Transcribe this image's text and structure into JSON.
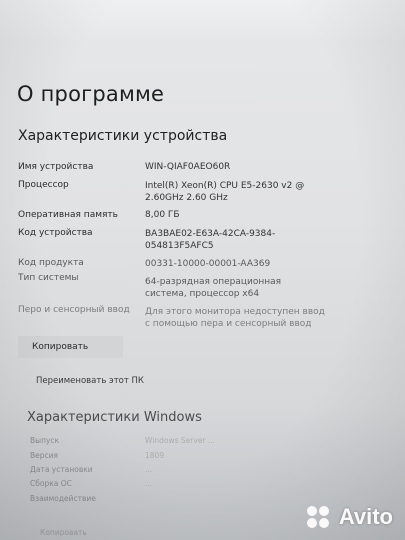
{
  "page": {
    "title": "О программе",
    "device_section_title": "Характеристики устройства"
  },
  "specs": [
    {
      "label": "Имя устройства",
      "value": "WIN-QIAF0AEO60R"
    },
    {
      "label": "Процессор",
      "value": "Intel(R) Xeon(R) CPU E5-2630 v2 @ 2.60GHz   2.60 GHz"
    },
    {
      "label": "Оперативная память",
      "value": "8,00 ГБ"
    },
    {
      "label": "Код устройства",
      "value": "BA3BAE02-E63A-42CA-9384-054813F5AFC5"
    },
    {
      "label": "Код продукта",
      "value": "00331-10000-00001-AA369"
    },
    {
      "label": "Тип системы",
      "value": "64-разрядная операционная система, процессор x64"
    },
    {
      "label": "Перо и сенсорный ввод",
      "value": "Для этого монитора недоступен ввод с помощью пера и сенсорный ввод"
    }
  ],
  "actions": {
    "copy_label": "Копировать",
    "rename_label": "Переименовать этот ПК"
  },
  "windows_section": {
    "title": "Характеристики Windows",
    "rows": [
      {
        "label": "Выпуск",
        "value": "Windows Server ..."
      },
      {
        "label": "Версия",
        "value": "1809"
      },
      {
        "label": "Дата установки",
        "value": "..."
      },
      {
        "label": "Сборка ОС",
        "value": "..."
      },
      {
        "label": "Взаимодействие",
        "value": ""
      }
    ],
    "copy_label": "Копировать"
  },
  "watermark": {
    "text": "Avito",
    "icon": "avito-logo-icon"
  }
}
